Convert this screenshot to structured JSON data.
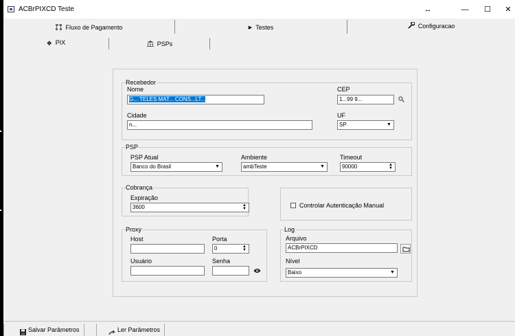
{
  "window": {
    "title": "ACBrPIXCD Teste",
    "restore_glyph": "↔",
    "minimize_glyph": "—",
    "maximize_glyph": "☐",
    "close_glyph": "✕"
  },
  "main_tabs": [
    {
      "label": "Fluxo de Pagamento",
      "icon": "flow-icon"
    },
    {
      "label": "Testes",
      "icon": "play-icon"
    },
    {
      "label": "Configuracao",
      "icon": "wrench-icon"
    }
  ],
  "sub_tabs": [
    {
      "label": "PIX",
      "icon": "pix-icon"
    },
    {
      "label": "PSPs",
      "icon": "bank-icon"
    }
  ],
  "recebedor": {
    "group": "Recebedor",
    "nome_label": "Nome",
    "nome_value": "G... TELES MAT... CONS...LT...",
    "cep_label": "CEP",
    "cep_value": "1...99 9...",
    "cidade_label": "Cidade",
    "cidade_value": "n...",
    "uf_label": "UF",
    "uf_value": "SP"
  },
  "psp": {
    "group": "PSP",
    "atual_label": "PSP Atual",
    "atual_value": "Banco do Brasil",
    "ambiente_label": "Ambiente",
    "ambiente_value": "ambTeste",
    "timeout_label": "Timeout",
    "timeout_value": "90000"
  },
  "cobranca": {
    "group": "Cobrança",
    "expiracao_label": "Expiração",
    "expiracao_value": "3600"
  },
  "autenticacao": {
    "label": "Controlar Autenticação Manual",
    "checked": false
  },
  "proxy": {
    "group": "Proxy",
    "host_label": "Host",
    "host_value": "",
    "porta_label": "Porta",
    "porta_value": "0",
    "usuario_label": "Usuário",
    "usuario_value": "",
    "senha_label": "Senha",
    "senha_value": ""
  },
  "log": {
    "group": "Log",
    "arquivo_label": "Arquivo",
    "arquivo_value": "ACBrPIXCD",
    "nivel_label": "Nível",
    "nivel_value": "Baixo"
  },
  "bottom": {
    "salvar_label": "Salvar Parâmetros",
    "ler_label": "Ler Parâmetros"
  }
}
